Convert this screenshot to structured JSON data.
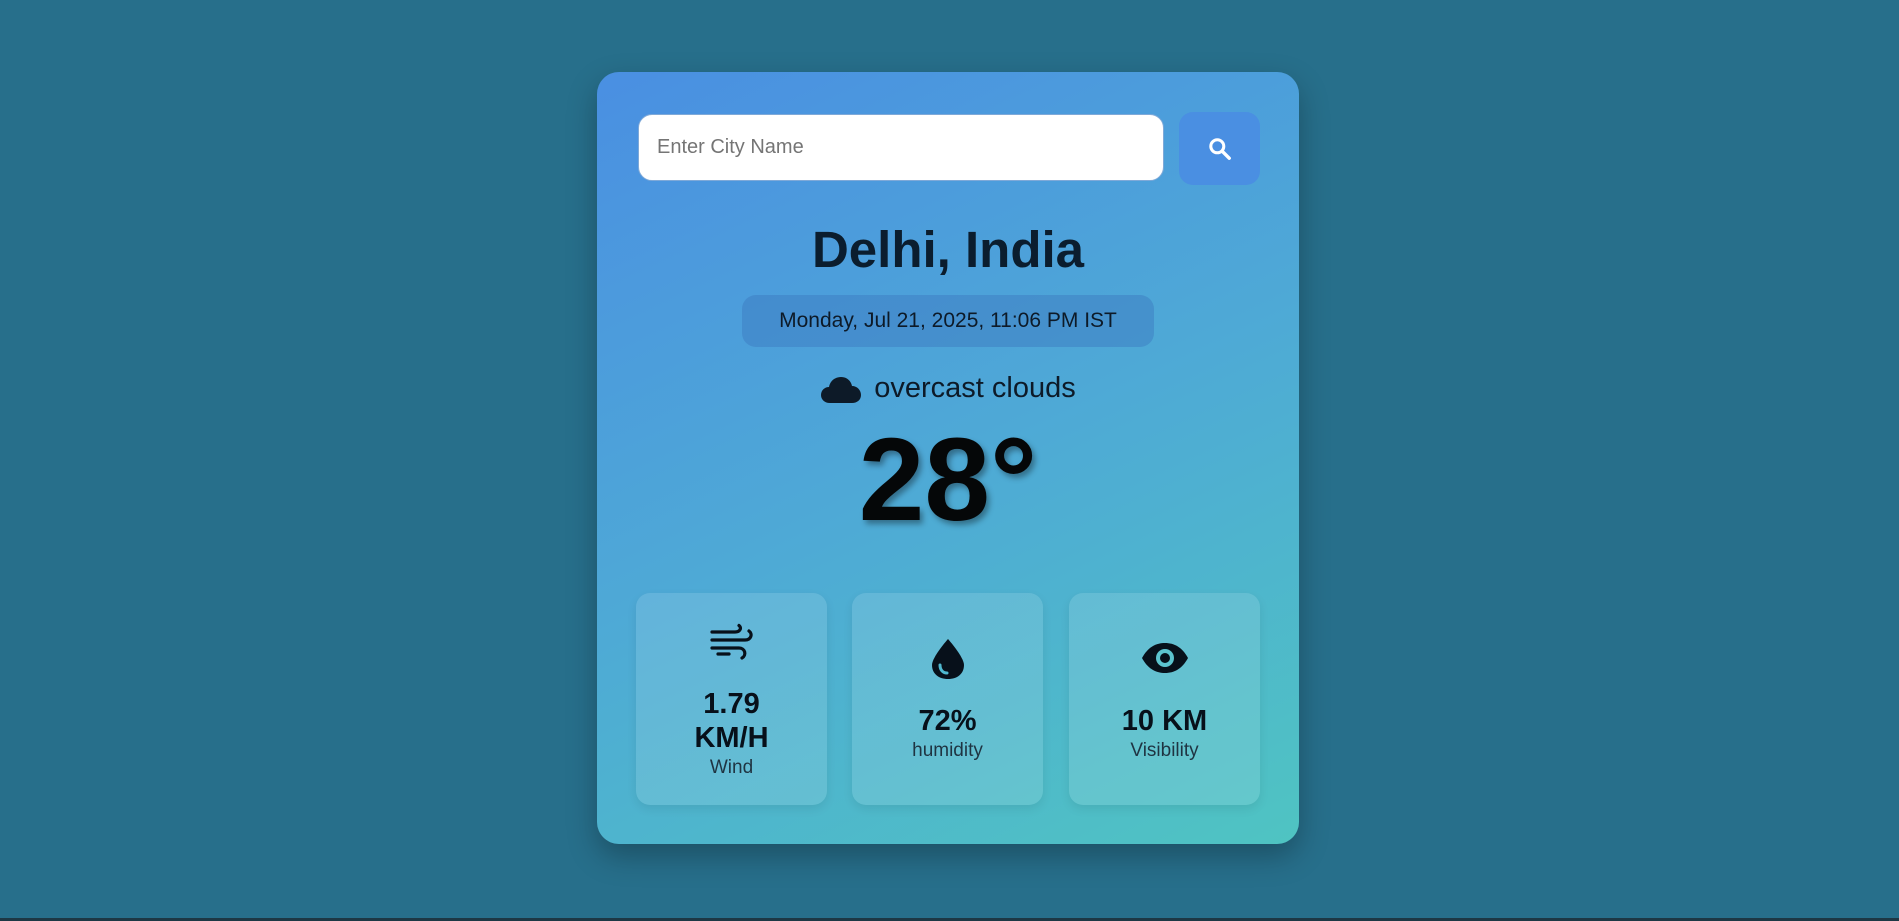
{
  "search": {
    "placeholder": "Enter City Name",
    "value": "",
    "button_icon": "search-icon"
  },
  "location": {
    "city": "Delhi, India",
    "datetime": "Monday, Jul 21, 2025, 11:06 PM IST"
  },
  "weather": {
    "condition_icon": "cloud-icon",
    "condition": "overcast clouds",
    "temperature": "28°"
  },
  "stats": [
    {
      "icon": "wind-icon",
      "value_line1": "1.79",
      "value_line2": "KM/H",
      "label": "Wind"
    },
    {
      "icon": "water-drop-icon",
      "value": "72%",
      "label": "humidity"
    },
    {
      "icon": "eye-icon",
      "value": "10 KM",
      "label": "Visibility"
    }
  ],
  "colors": {
    "page_background": "#276f8b",
    "card_gradient_start": "#4a8fe2",
    "card_gradient_end": "#4fc4c2",
    "search_button": "#4a8fe2"
  }
}
